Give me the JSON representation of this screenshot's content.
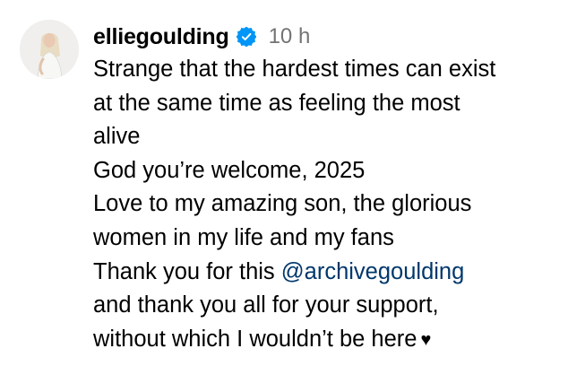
{
  "comment": {
    "username": "elliegoulding",
    "verified_icon": "verified-badge-icon",
    "timestamp": "10 h",
    "lines": [
      "Strange that the hardest times can exist",
      "at the same time as feeling the most",
      "alive",
      "God you’re welcome, 2025",
      "Love to my amazing son, the glorious",
      "women in my life and my fans"
    ],
    "line7_prefix": "Thank you for this ",
    "mention": "@archivegoulding",
    "line8": "and thank you all for your support,",
    "line9": "without which I wouldn’t be here",
    "heart": "♥",
    "colors": {
      "verified_blue": "#0095f6",
      "mention": "#00376b",
      "timestamp": "#737373"
    }
  }
}
